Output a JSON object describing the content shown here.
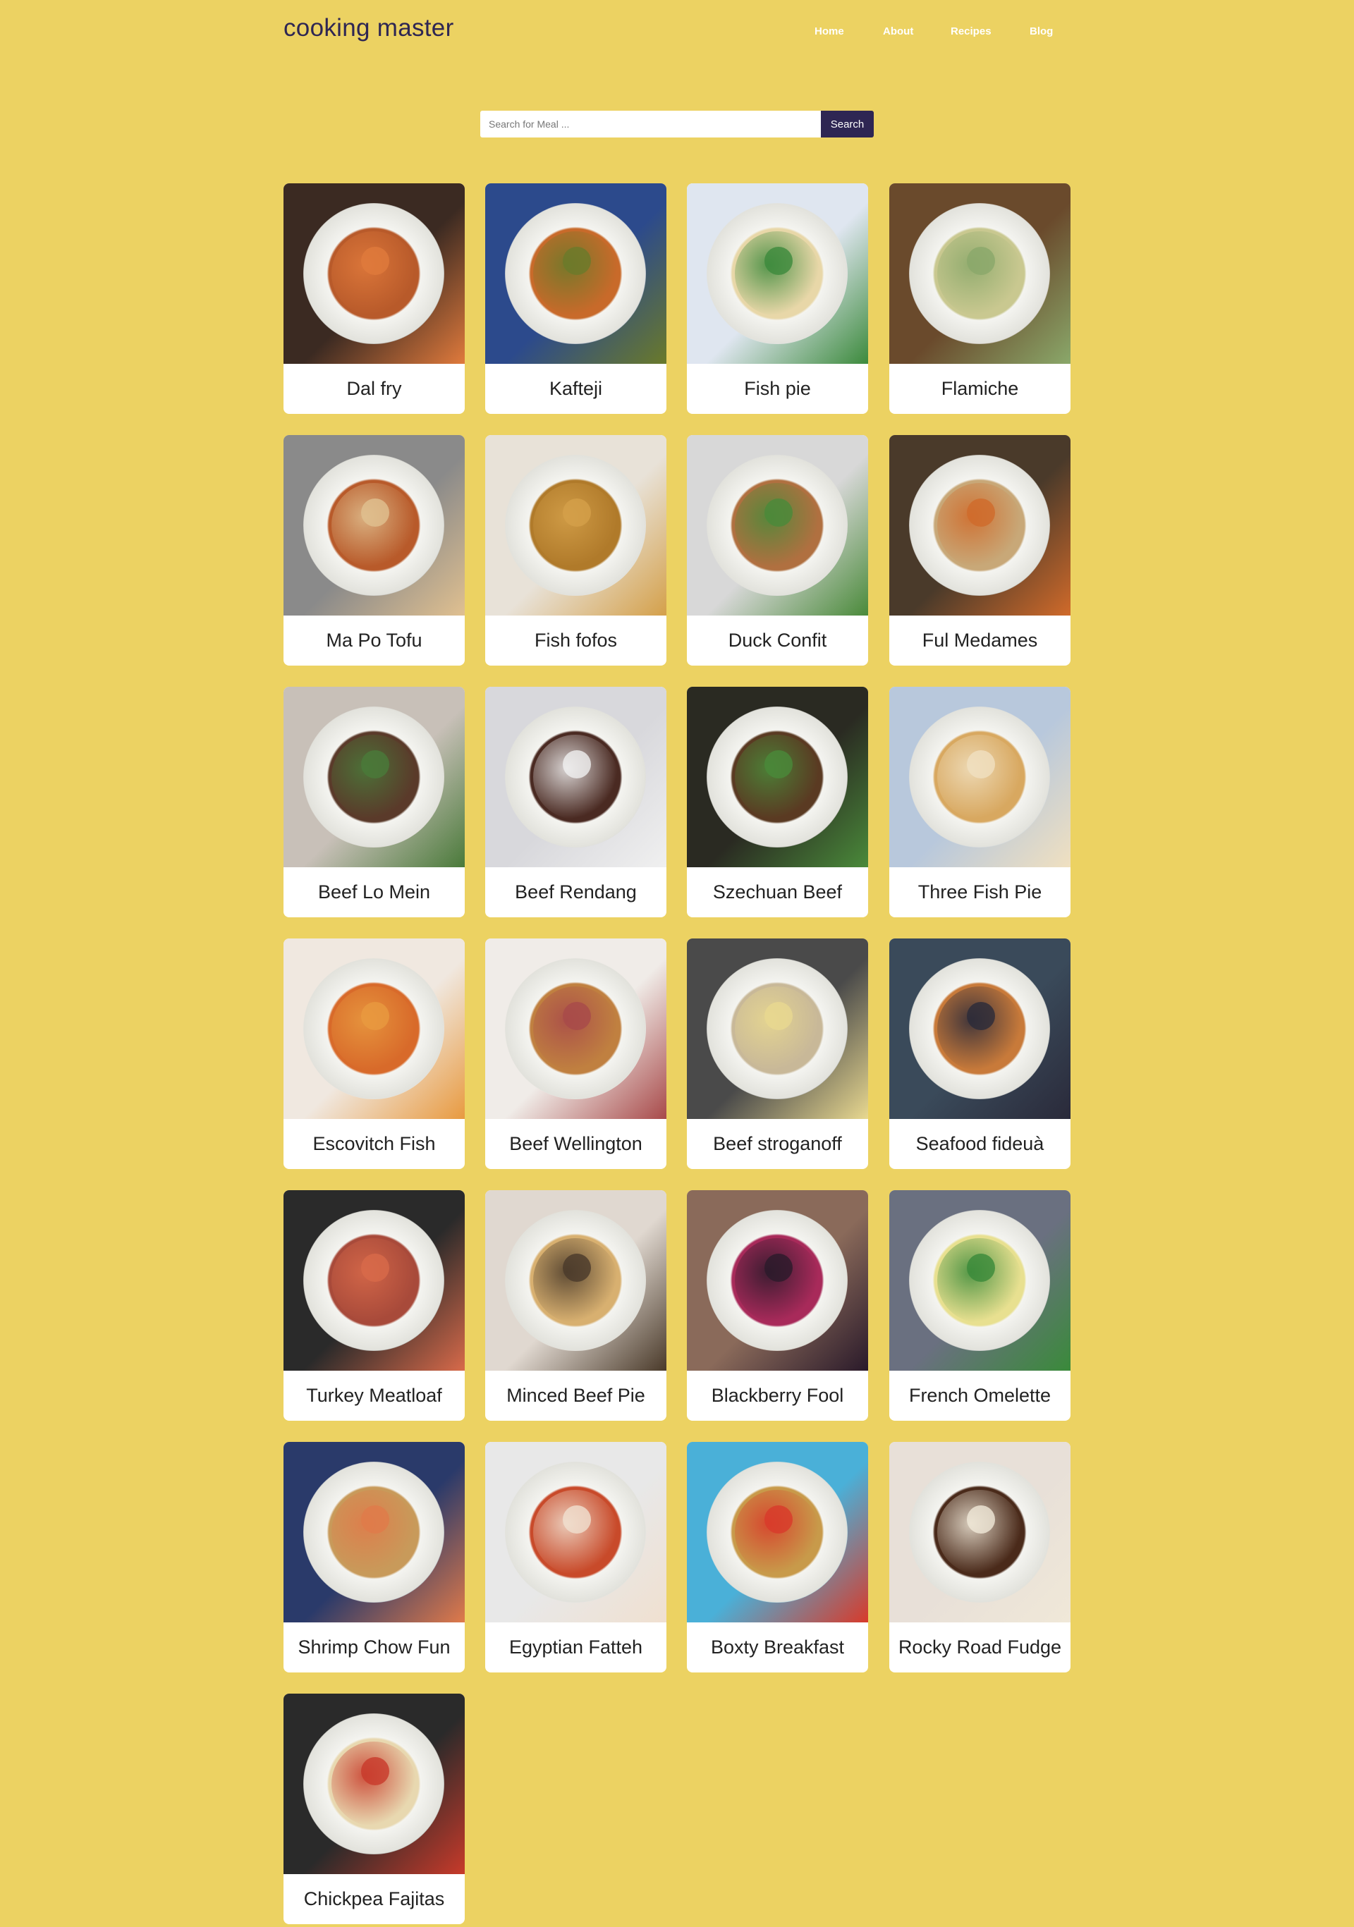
{
  "header": {
    "brand": "cooking master",
    "nav": [
      "Home",
      "About",
      "Recipes",
      "Blog"
    ]
  },
  "search": {
    "placeholder": "Search for Meal ...",
    "value": "",
    "button_label": "Search"
  },
  "meals": [
    {
      "name": "Dal fry",
      "colors": [
        "#3b2a22",
        "#b85a2a",
        "#e07a3c"
      ]
    },
    {
      "name": "Kafteji",
      "colors": [
        "#2c4a8c",
        "#c86a2a",
        "#6a7a2a"
      ]
    },
    {
      "name": "Fish pie",
      "colors": [
        "#dfe6f0",
        "#e8d7a8",
        "#3c8a3c"
      ]
    },
    {
      "name": "Flamiche",
      "colors": [
        "#6a4a2c",
        "#c9c890",
        "#8aa86a"
      ]
    },
    {
      "name": "Ma Po Tofu",
      "colors": [
        "#8a8a8a",
        "#b85a2a",
        "#e0c090"
      ]
    },
    {
      "name": "Fish fofos",
      "colors": [
        "#e8e2d8",
        "#b07a2a",
        "#d4a04a"
      ]
    },
    {
      "name": "Duck Confit",
      "colors": [
        "#d8d8d8",
        "#b07040",
        "#4a8a3a"
      ]
    },
    {
      "name": "Ful Medames",
      "colors": [
        "#4a3a2a",
        "#c8a878",
        "#d06a2a"
      ]
    },
    {
      "name": "Beef Lo Mein",
      "colors": [
        "#c8c0b8",
        "#5a3a2a",
        "#4a7a3a"
      ]
    },
    {
      "name": "Beef Rendang",
      "colors": [
        "#d8d8dc",
        "#4a2a22",
        "#f0f0f0"
      ]
    },
    {
      "name": "Szechuan Beef",
      "colors": [
        "#2a2a22",
        "#5a3a22",
        "#4a8a3a"
      ]
    },
    {
      "name": "Three Fish Pie",
      "colors": [
        "#b8c8dc",
        "#d8a860",
        "#f0e0c0"
      ]
    },
    {
      "name": "Escovitch Fish",
      "colors": [
        "#f0e8e0",
        "#d86a2a",
        "#e89a40"
      ]
    },
    {
      "name": "Beef Wellington",
      "colors": [
        "#f0ece8",
        "#c08040",
        "#a84a4a"
      ]
    },
    {
      "name": "Beef stroganoff",
      "colors": [
        "#4a4a4a",
        "#c8b898",
        "#e8d890"
      ]
    },
    {
      "name": "Seafood fideuà",
      "colors": [
        "#3a4a5a",
        "#c87a3a",
        "#2a2a3a"
      ]
    },
    {
      "name": "Turkey Meatloaf",
      "colors": [
        "#2a2a2a",
        "#a84a3a",
        "#d86a4a"
      ]
    },
    {
      "name": "Minced Beef Pie",
      "colors": [
        "#e0d8d0",
        "#d8b070",
        "#4a3a2a"
      ]
    },
    {
      "name": "Blackberry Fool",
      "colors": [
        "#8a6a5a",
        "#a82a5a",
        "#2a1a2a"
      ]
    },
    {
      "name": "French Omelette",
      "colors": [
        "#6a7080",
        "#e8e090",
        "#3a8a3a"
      ]
    },
    {
      "name": "Shrimp Chow Fun",
      "colors": [
        "#2a3a6a",
        "#c89a5a",
        "#e07a4a"
      ]
    },
    {
      "name": "Egyptian Fatteh",
      "colors": [
        "#e8e8e8",
        "#c84a2a",
        "#f0e0d0"
      ]
    },
    {
      "name": "Boxty Breakfast",
      "colors": [
        "#4ab0d8",
        "#c89a4a",
        "#d83a2a"
      ]
    },
    {
      "name": "Rocky Road Fudge",
      "colors": [
        "#e8e0d8",
        "#4a2a1a",
        "#f0e8d8"
      ]
    },
    {
      "name": "Chickpea Fajitas",
      "colors": [
        "#2a2a2a",
        "#e8d8b0",
        "#c83a2a"
      ]
    }
  ]
}
